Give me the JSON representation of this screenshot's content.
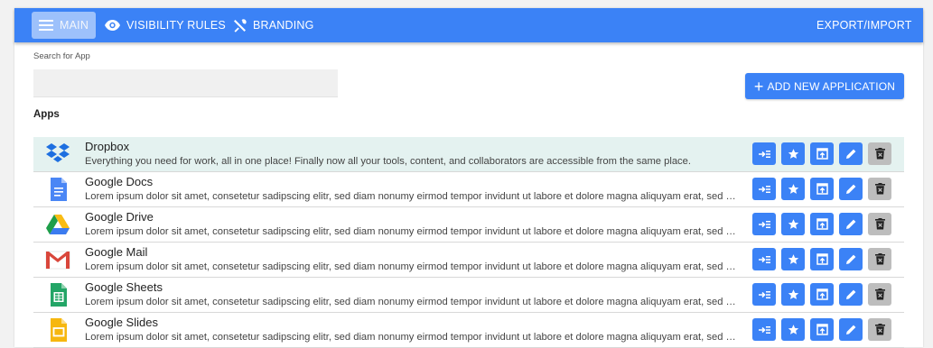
{
  "nav": {
    "main_label": "MAIN",
    "visibility_label": "VISIBILITY RULES",
    "branding_label": "BRANDING",
    "export_label": "EXPORT/IMPORT"
  },
  "search": {
    "label": "Search for App",
    "value": "",
    "placeholder": ""
  },
  "add_button_label": "ADD NEW APPLICATION",
  "apps_heading": "Apps",
  "apps": [
    {
      "name": "Dropbox",
      "icon": "dropbox-icon",
      "description": "Everything you need for work, all in one place!  Finally now all your tools, content, and collaborators are accessible from the same place."
    },
    {
      "name": "Google Docs",
      "icon": "google-docs-icon",
      "description": "Lorem ipsum dolor sit amet, consetetur sadipscing elitr, sed diam nonumy eirmod tempor invidunt ut labore et dolore magna aliquyam erat, sed diam voluptua."
    },
    {
      "name": "Google Drive",
      "icon": "google-drive-icon",
      "description": "Lorem ipsum dolor sit amet, consetetur sadipscing elitr, sed diam nonumy eirmod tempor invidunt ut labore et dolore magna aliquyam erat, sed diam voluptua."
    },
    {
      "name": "Google Mail",
      "icon": "gmail-icon",
      "description": "Lorem ipsum dolor sit amet, consetetur sadipscing elitr, sed diam nonumy eirmod tempor invidunt ut labore et dolore magna aliquyam erat, sed diam voluptua."
    },
    {
      "name": "Google Sheets",
      "icon": "google-sheets-icon",
      "description": "Lorem ipsum dolor sit amet, consetetur sadipscing elitr, sed diam nonumy eirmod tempor invidunt ut labore et dolore magna aliquyam erat, sed diam voluptua."
    },
    {
      "name": "Google Slides",
      "icon": "google-slides-icon",
      "description": "Lorem ipsum dolor sit amet, consetetur sadipscing elitr, sed diam nonumy eirmod tempor invidunt ut labore et dolore magna aliquyam erat, sed diam voluptua."
    }
  ],
  "selected_app": "Dropbox",
  "row_actions": [
    "move-icon",
    "star-icon",
    "open-in-new-icon",
    "edit-pencil-icon",
    "delete-trash-icon"
  ],
  "colors": {
    "accent": "#3b82f6",
    "selected_row": "#e4f2f0",
    "delete_button": "#bdbdbd"
  }
}
